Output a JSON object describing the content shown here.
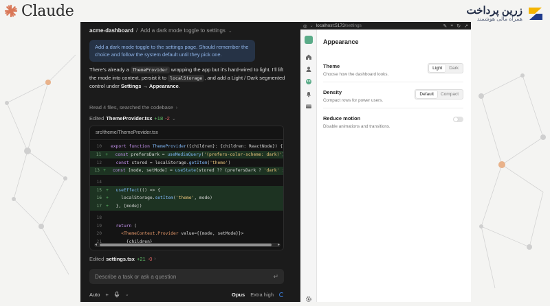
{
  "branding": {
    "left_name": "Claude",
    "right_name": "زرین پرداخت",
    "right_tagline": "همراه مالی هوشمند"
  },
  "chat": {
    "project": "acme-dashboard",
    "separator": "/",
    "thread_title": "Add a dark mode toggle to settings",
    "user_message": "Add a dark mode toggle to the settings page. Should remember the choice and follow the system default until they pick one.",
    "assistant": {
      "t1": "There's already a ",
      "c1": "ThemeProvider",
      "t2": " wrapping the app but it's hard-wired to light. I'll lift the mode into context, persist it to ",
      "c2": "localStorage",
      "t3": ", and add a Light / Dark segmented control under ",
      "b1": "Settings → Appearance",
      "t4": "."
    },
    "activity": "Read 4 files, searched the codebase",
    "edit1": {
      "prefix": "Edited",
      "file": "ThemeProvider.tsx",
      "added": "+18",
      "removed": "-2"
    },
    "edit2": {
      "prefix": "Edited",
      "file": "settings.tsx",
      "added": "+21",
      "removed": "-0"
    },
    "diff": {
      "path": "src/theme/ThemeProvider.tsx",
      "lines": [
        {
          "n": "10",
          "sign": "",
          "code": "export function ThemeProvider({children}: {children: ReactNode}) {",
          "added": false
        },
        {
          "n": "11",
          "sign": "+",
          "code": "  const prefersDark = useMediaQuery('(prefers-color-scheme: dark)')",
          "added": true
        },
        {
          "n": "12",
          "sign": "",
          "code": "  const stored = localStorage.getItem('theme')",
          "added": false
        },
        {
          "n": "13",
          "sign": "+",
          "code": "  const [mode, setMode] = useState(stored ?? (prefersDark ? 'dark' :",
          "added": true
        },
        {
          "n": "14",
          "sign": "",
          "code": "",
          "added": false
        },
        {
          "n": "15",
          "sign": "+",
          "code": "  useEffect(() => {",
          "added": true
        },
        {
          "n": "16",
          "sign": "+",
          "code": "    localStorage.setItem('theme', mode)",
          "added": true
        },
        {
          "n": "17",
          "sign": "+",
          "code": "  }, [mode])",
          "added": true
        },
        {
          "n": "18",
          "sign": "",
          "code": "",
          "added": false
        },
        {
          "n": "19",
          "sign": "",
          "code": "  return (",
          "added": false
        },
        {
          "n": "20",
          "sign": "",
          "code": "    <ThemeContext.Provider value={{mode, setMode}}>",
          "added": false
        },
        {
          "n": "21",
          "sign": "",
          "code": "      {children}",
          "added": false
        }
      ]
    },
    "composer_placeholder": "Describe a task or ask a question",
    "footer": {
      "mode": "Auto",
      "model": "Opus",
      "effort": "Extra high"
    }
  },
  "preview": {
    "url_host": "localhost:5173",
    "url_path": "/settings",
    "page_title": "Appearance",
    "settings": [
      {
        "label": "Theme",
        "desc": "Choose how the dashboard looks.",
        "options": [
          "Light",
          "Dark"
        ],
        "selected": "Light"
      },
      {
        "label": "Density",
        "desc": "Compact rows for power users.",
        "options": [
          "Default",
          "Compact"
        ],
        "selected": "Default"
      },
      {
        "label": "Reduce motion",
        "desc": "Disable animations and transitions.",
        "toggle_on": false
      }
    ]
  },
  "colors": {
    "app_bg": "#1b1b1b",
    "user_bubble": "#263346",
    "diff_add": "#1d3322",
    "accent_green": "#5aab88",
    "added_text": "#62c06a",
    "removed_text": "#e06464"
  }
}
